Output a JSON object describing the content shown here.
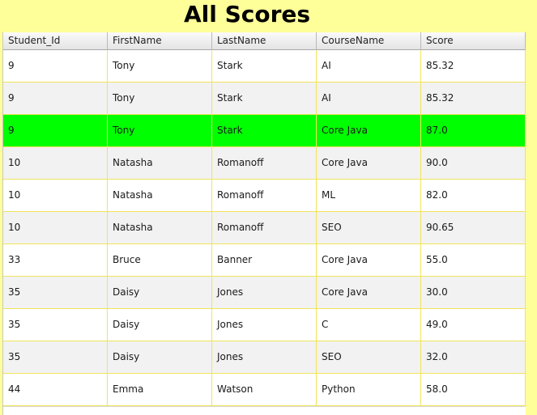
{
  "page": {
    "title": "All Scores"
  },
  "colors": {
    "background": "#ffff99",
    "selected_row": "#00ff00",
    "grid_line": "#f0e45a",
    "alt_row": "#f2f2f2"
  },
  "table": {
    "columns": [
      "Student_Id",
      "FirstName",
      "LastName",
      "CourseName",
      "Score"
    ],
    "selected_row_index": 2,
    "rows": [
      [
        "9",
        "Tony",
        "Stark",
        "AI",
        "85.32"
      ],
      [
        "9",
        "Tony",
        "Stark",
        "AI",
        "85.32"
      ],
      [
        "9",
        "Tony",
        "Stark",
        "Core Java",
        "87.0"
      ],
      [
        "10",
        "Natasha",
        "Romanoff",
        "Core Java",
        "90.0"
      ],
      [
        "10",
        "Natasha",
        "Romanoff",
        "ML",
        "82.0"
      ],
      [
        "10",
        "Natasha",
        "Romanoff",
        "SEO",
        "90.65"
      ],
      [
        "33",
        "Bruce",
        "Banner",
        "Core Java",
        "55.0"
      ],
      [
        "35",
        "Daisy",
        "Jones",
        "Core Java",
        "30.0"
      ],
      [
        "35",
        "Daisy",
        "Jones",
        "C",
        "49.0"
      ],
      [
        "35",
        "Daisy",
        "Jones",
        "SEO",
        "32.0"
      ],
      [
        "44",
        "Emma",
        "Watson",
        "Python",
        "58.0"
      ]
    ]
  }
}
